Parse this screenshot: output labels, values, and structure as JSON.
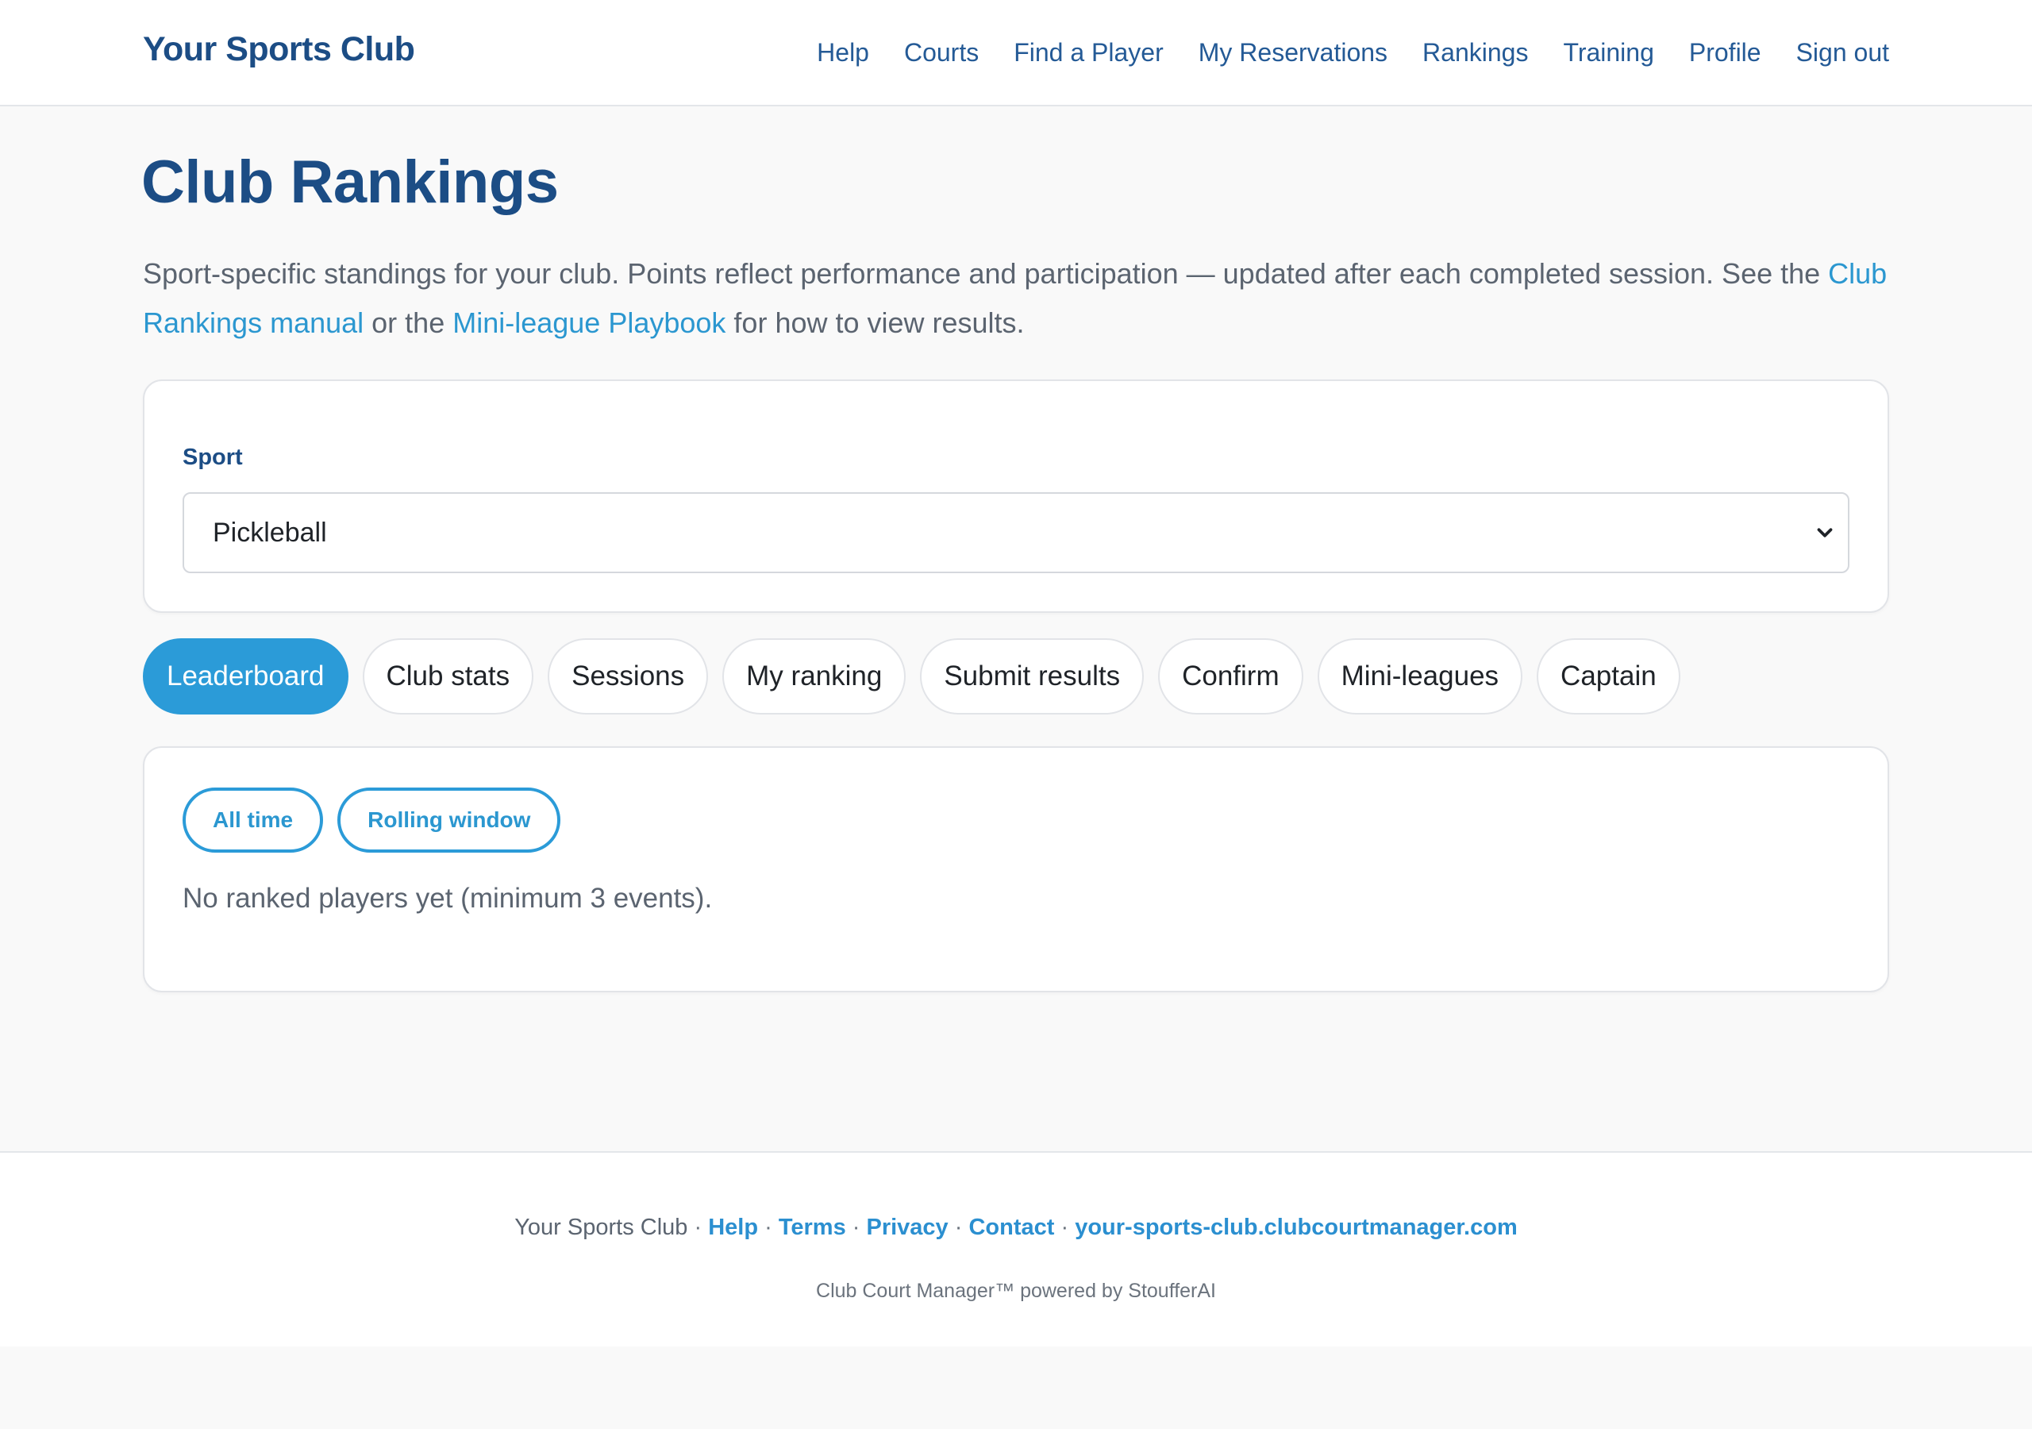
{
  "header": {
    "brand": "Your Sports Club",
    "nav": [
      "Help",
      "Courts",
      "Find a Player",
      "My Reservations",
      "Rankings",
      "Training",
      "Profile",
      "Sign out"
    ]
  },
  "page": {
    "title": "Club Rankings",
    "intro_text_1": "Sport-specific standings for your club. Points reflect performance and participation — updated after each completed session. See the ",
    "intro_link_1": "Club Rankings manual",
    "intro_text_2": " or the ",
    "intro_link_2": "Mini-league Playbook",
    "intro_text_3": " for how to view results."
  },
  "sport_filter": {
    "label": "Sport",
    "selected": "Pickleball"
  },
  "tabs": [
    {
      "label": "Leaderboard",
      "active": true
    },
    {
      "label": "Club stats",
      "active": false
    },
    {
      "label": "Sessions",
      "active": false
    },
    {
      "label": "My ranking",
      "active": false
    },
    {
      "label": "Submit results",
      "active": false
    },
    {
      "label": "Confirm",
      "active": false
    },
    {
      "label": "Mini-leagues",
      "active": false
    },
    {
      "label": "Captain",
      "active": false
    }
  ],
  "leaderboard": {
    "filters": [
      "All time",
      "Rolling window"
    ],
    "empty_message": "No ranked players yet (minimum 3 events)."
  },
  "footer": {
    "club_name": "Your Sports Club",
    "links": [
      "Help",
      "Terms",
      "Privacy",
      "Contact",
      "your-sports-club.clubcourtmanager.com"
    ],
    "powered_by": "Club Court Manager™ powered by StoufferAI"
  },
  "colors": {
    "brand": "#1c4d85",
    "accent": "#2b9bd8",
    "background": "#f9f9f9"
  }
}
